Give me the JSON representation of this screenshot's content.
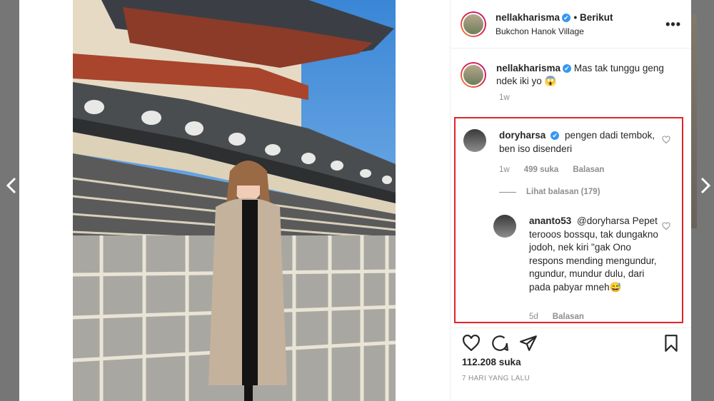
{
  "header": {
    "username": "nellakharisma",
    "verified_mark": "✔",
    "follow_label": "• Berikut",
    "location": "Bukchon Hanok Village",
    "more_label": "•••"
  },
  "caption": {
    "username": "nellakharisma",
    "text": "Mas tak tunggu geng ndek iki yo 😱",
    "time": "1w"
  },
  "comments": [
    {
      "username": "doryharsa",
      "verified": true,
      "text": "pengen dadi tembok, ben iso disenderi",
      "time": "1w",
      "likes": "499 suka",
      "reply_label": "Balasan",
      "view_replies": "Lihat balasan (179)"
    },
    {
      "username": "ananto53",
      "mention": "@doryharsa",
      "text": "Pepet terooos bossqu, tak dungakno jodoh, nek kiri \"gak Ono respons mending mengundur, ngundur, mundur dulu, dari pada pabyar mneh😅",
      "time": "5d",
      "reply_label": "Balasan"
    }
  ],
  "post": {
    "likes": "112.208 suka",
    "time": "7 HARI YANG LALU"
  },
  "icons": {
    "like": "heart-icon",
    "comment": "comment-bubble-icon",
    "share": "paper-plane-icon",
    "save": "bookmark-icon"
  },
  "colors": {
    "highlight_box": "#e12427",
    "verified": "#3897f0",
    "secondary_text": "#8e8e8e"
  }
}
